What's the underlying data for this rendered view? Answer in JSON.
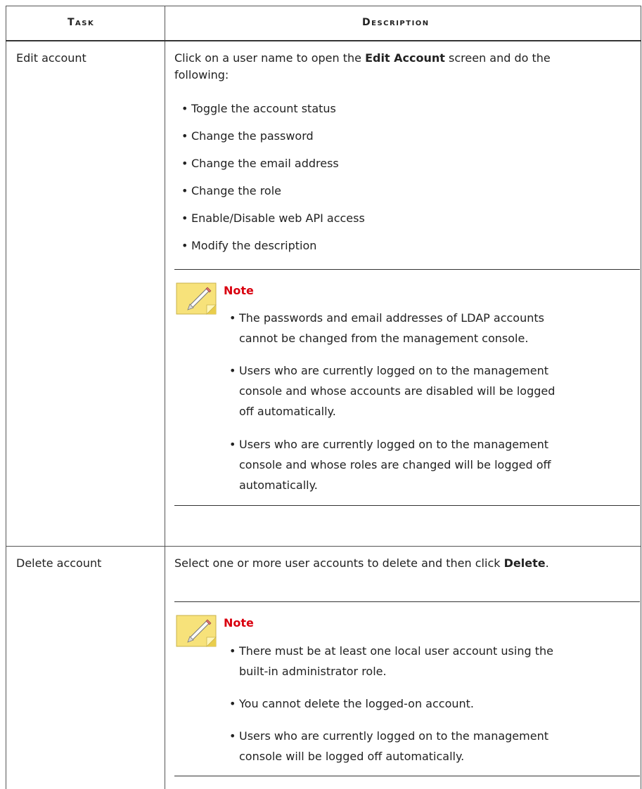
{
  "table": {
    "headers": {
      "task": "Task",
      "description": "Description"
    },
    "rows": [
      {
        "task": "Edit account",
        "intro_line1_pre": "Click on a user name to open the ",
        "intro_line1_bold": "Edit Account",
        "intro_line1_post": " screen and do the",
        "intro_line2": "following:",
        "bullets": [
          "Toggle the account status",
          "Change the password",
          "Change the email address",
          "Change the role",
          "Enable/Disable web API access",
          "Modify the description"
        ],
        "note": {
          "title": "Note",
          "items": [
            [
              "The passwords and email addresses of LDAP accounts",
              "cannot be changed from the management console."
            ],
            [
              "Users who are currently logged on to the management",
              "console and whose accounts are disabled will be logged",
              "off automatically."
            ],
            [
              "Users who are currently logged on to the management",
              "console and whose roles are changed will be logged off",
              "automatically."
            ]
          ]
        }
      },
      {
        "task": "Delete account",
        "intro_pre": "Select one or more user accounts to delete and then click ",
        "intro_bold": "Delete",
        "intro_post": ".",
        "note": {
          "title": "Note",
          "items": [
            [
              "There must be at least one local user account using the",
              "built-in administrator role."
            ],
            [
              "You cannot delete the logged-on account."
            ],
            [
              "Users who are currently logged on to the management",
              "console will be logged off automatically."
            ]
          ]
        }
      }
    ]
  },
  "icons": {
    "note_icon": "note-pencil-icon"
  },
  "colors": {
    "note_title": "#d9000f",
    "note_icon_fill": "#f7e27a",
    "rule": "#333333"
  }
}
